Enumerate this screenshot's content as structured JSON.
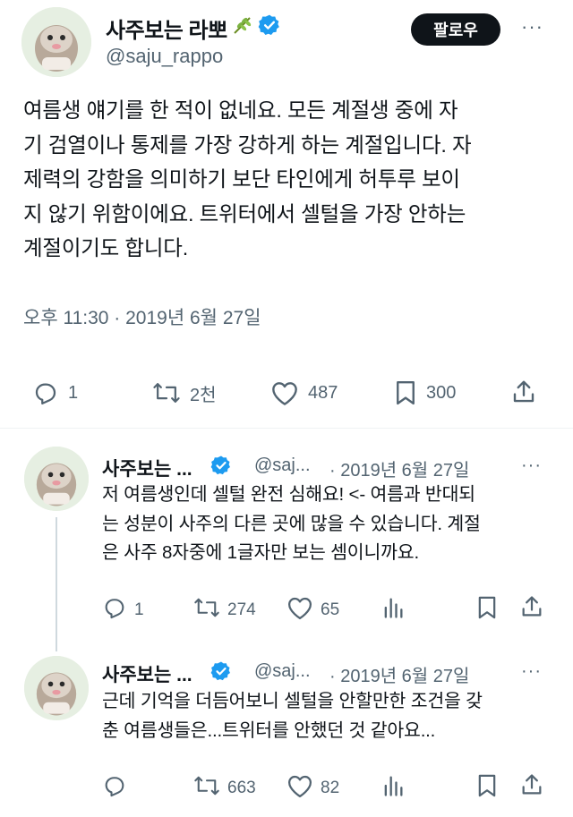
{
  "main_tweet": {
    "display_name": "사주보는 라뽀",
    "handle": "@saju_rappo",
    "follow_label": "팔로우",
    "more_label": "···",
    "text_lines": [
      "여름생 얘기를 한 적이 없네요. 모든 계절생 중에 자",
      "기 검열이나 통제를 가장 강하게 하는 계절입니다. 자",
      "제력의 강함을 의미하기 보단 타인에게 허투루 보이",
      "지 않기 위함이에요. 트위터에서 셀털을 가장 안하는",
      "계절이기도 합니다."
    ],
    "timestamp": "오후 11:30 · 2019년 6월 27일",
    "stats": {
      "replies": "1",
      "retweets": "2천",
      "likes": "487",
      "bookmarks": "300"
    },
    "icons": [
      "leaf-emoji-icon",
      "verified-badge-icon",
      "reply-icon",
      "retweet-icon",
      "like-icon",
      "bookmark-icon",
      "share-icon"
    ]
  },
  "replies": [
    {
      "display_name": "사주보는 ...",
      "handle": "@saj...",
      "date": "· 2019년 6월 27일",
      "more_label": "···",
      "text_lines": [
        "저 여름생인데 셀털 완전 심해요! <- 여름과 반대되",
        "는 성분이 사주의 다른 곳에 많을 수 있습니다. 계절",
        "은 사주 8자중에 1글자만 보는 셈이니까요."
      ],
      "stats": {
        "replies": "1",
        "retweets": "274",
        "likes": "65"
      }
    },
    {
      "display_name": "사주보는 ...",
      "handle": "@saj...",
      "date": "· 2019년 6월 27일",
      "more_label": "···",
      "text_lines": [
        "근데 기억을 더듬어보니 셀털을 안할만한 조건을 갖",
        "춘 여름생들은...트위터를 안했던 것 같아요..."
      ],
      "stats": {
        "replies": "",
        "retweets": "663",
        "likes": "82"
      }
    }
  ],
  "colors": {
    "text": "#0f1419",
    "secondary": "#536471",
    "verified": "#1d9bf0",
    "follow_bg": "#0f1419",
    "thread_line": "#cfd9de",
    "avatar_bg": "#e6efe2"
  }
}
